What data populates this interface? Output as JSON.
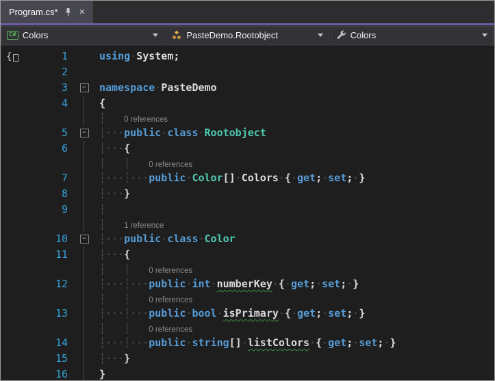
{
  "tab": {
    "title": "Program.cs*",
    "close_glyph": "×"
  },
  "navbar": {
    "project": {
      "icon_text": "C#",
      "label": "Colors"
    },
    "type_combo": {
      "label": "PasteDemo.Rootobject"
    },
    "member_combo": {
      "label": "Colors"
    }
  },
  "colors": {
    "accent_divider": "#6C5FA5",
    "tab_background": "#46464F",
    "navbar_background": "#2D2D30",
    "editor_background": "#1E1E1E",
    "keyword": "#569CD6",
    "type_name": "#4EC9B0",
    "plain_text": "#DCDCDC",
    "line_number": "#35A0D8",
    "codelens_text": "#8A8A8A",
    "whitespace_dot": "#4A5A55",
    "indent_guide": "#4F4F4F",
    "class_icon": "#D8A243",
    "csharp_icon": "#5BB75B"
  },
  "editor": {
    "rows": [
      {
        "kind": "code",
        "num": "1",
        "fold": "",
        "segs": [
          [
            "kw",
            "using"
          ],
          [
            "ws",
            "·"
          ],
          [
            "pl",
            "System;"
          ]
        ]
      },
      {
        "kind": "code",
        "num": "2",
        "fold": "",
        "segs": []
      },
      {
        "kind": "code",
        "num": "3",
        "fold": "box",
        "segs": [
          [
            "kw",
            "namespace"
          ],
          [
            "ws",
            "·"
          ],
          [
            "pl",
            "PasteDemo"
          ]
        ]
      },
      {
        "kind": "code",
        "num": "4",
        "fold": "line",
        "segs": [
          [
            "pl",
            "{"
          ]
        ]
      },
      {
        "kind": "lens",
        "num": "",
        "fold": "line",
        "segs": [
          [
            "gd",
            "┆"
          ],
          [
            "sp",
            "   "
          ],
          [
            "lens",
            "0 references"
          ]
        ]
      },
      {
        "kind": "code",
        "num": "5",
        "fold": "box",
        "segs": [
          [
            "gd",
            "┆"
          ],
          [
            "ws",
            "···"
          ],
          [
            "kw",
            "public"
          ],
          [
            "ws",
            "·"
          ],
          [
            "kw",
            "class"
          ],
          [
            "ws",
            "·"
          ],
          [
            "ty",
            "Rootobject"
          ]
        ]
      },
      {
        "kind": "code",
        "num": "6",
        "fold": "line",
        "segs": [
          [
            "gd",
            "┆"
          ],
          [
            "ws",
            "···"
          ],
          [
            "pl",
            "{"
          ]
        ]
      },
      {
        "kind": "lens",
        "num": "",
        "fold": "line",
        "segs": [
          [
            "gd",
            "┆"
          ],
          [
            "sp",
            "   "
          ],
          [
            "gd",
            "┆"
          ],
          [
            "sp",
            "   "
          ],
          [
            "lens",
            "0 references"
          ]
        ]
      },
      {
        "kind": "code",
        "num": "7",
        "fold": "line",
        "segs": [
          [
            "gd",
            "┆"
          ],
          [
            "ws",
            "···"
          ],
          [
            "gd",
            "┆"
          ],
          [
            "ws",
            "···"
          ],
          [
            "kw",
            "public"
          ],
          [
            "ws",
            "·"
          ],
          [
            "ty",
            "Color"
          ],
          [
            "pl",
            "[]"
          ],
          [
            "ws",
            "·"
          ],
          [
            "pl",
            "Colors"
          ],
          [
            "ws",
            "·"
          ],
          [
            "pl",
            "{"
          ],
          [
            "ws",
            "·"
          ],
          [
            "kw",
            "get"
          ],
          [
            "pl",
            ";"
          ],
          [
            "ws",
            "·"
          ],
          [
            "kw",
            "set"
          ],
          [
            "pl",
            ";"
          ],
          [
            "ws",
            "·"
          ],
          [
            "pl",
            "}"
          ]
        ]
      },
      {
        "kind": "code",
        "num": "8",
        "fold": "line",
        "segs": [
          [
            "gd",
            "┆"
          ],
          [
            "ws",
            "···"
          ],
          [
            "pl",
            "}"
          ]
        ]
      },
      {
        "kind": "code",
        "num": "9",
        "fold": "line",
        "segs": [
          [
            "gd",
            "┆"
          ]
        ]
      },
      {
        "kind": "lens",
        "num": "",
        "fold": "line",
        "segs": [
          [
            "gd",
            "┆"
          ],
          [
            "sp",
            "   "
          ],
          [
            "lens",
            "1 reference"
          ]
        ]
      },
      {
        "kind": "code",
        "num": "10",
        "fold": "box",
        "segs": [
          [
            "gd",
            "┆"
          ],
          [
            "ws",
            "···"
          ],
          [
            "kw",
            "public"
          ],
          [
            "ws",
            "·"
          ],
          [
            "kw",
            "class"
          ],
          [
            "ws",
            "·"
          ],
          [
            "ty",
            "Color"
          ]
        ]
      },
      {
        "kind": "code",
        "num": "11",
        "fold": "line",
        "segs": [
          [
            "gd",
            "┆"
          ],
          [
            "ws",
            "···"
          ],
          [
            "pl",
            "{"
          ]
        ]
      },
      {
        "kind": "lens",
        "num": "",
        "fold": "line",
        "segs": [
          [
            "gd",
            "┆"
          ],
          [
            "sp",
            "   "
          ],
          [
            "gd",
            "┆"
          ],
          [
            "sp",
            "   "
          ],
          [
            "lens",
            "0 references"
          ]
        ]
      },
      {
        "kind": "code",
        "num": "12",
        "fold": "line",
        "segs": [
          [
            "gd",
            "┆"
          ],
          [
            "ws",
            "···"
          ],
          [
            "gd",
            "┆"
          ],
          [
            "ws",
            "···"
          ],
          [
            "kw",
            "public"
          ],
          [
            "ws",
            "·"
          ],
          [
            "kw",
            "int"
          ],
          [
            "ws",
            "·"
          ],
          [
            "plu",
            "numberKey"
          ],
          [
            "ws",
            "·"
          ],
          [
            "pl",
            "{"
          ],
          [
            "ws",
            "·"
          ],
          [
            "kw",
            "get"
          ],
          [
            "pl",
            ";"
          ],
          [
            "ws",
            "·"
          ],
          [
            "kw",
            "set"
          ],
          [
            "pl",
            ";"
          ],
          [
            "ws",
            "·"
          ],
          [
            "pl",
            "}"
          ]
        ]
      },
      {
        "kind": "lens",
        "num": "",
        "fold": "line",
        "segs": [
          [
            "gd",
            "┆"
          ],
          [
            "sp",
            "   "
          ],
          [
            "gd",
            "┆"
          ],
          [
            "sp",
            "   "
          ],
          [
            "lens",
            "0 references"
          ]
        ]
      },
      {
        "kind": "code",
        "num": "13",
        "fold": "line",
        "segs": [
          [
            "gd",
            "┆"
          ],
          [
            "ws",
            "···"
          ],
          [
            "gd",
            "┆"
          ],
          [
            "ws",
            "···"
          ],
          [
            "kw",
            "public"
          ],
          [
            "ws",
            "·"
          ],
          [
            "kw",
            "bool"
          ],
          [
            "ws",
            "·"
          ],
          [
            "plu",
            "isPrimary"
          ],
          [
            "ws",
            "·"
          ],
          [
            "pl",
            "{"
          ],
          [
            "ws",
            "·"
          ],
          [
            "kw",
            "get"
          ],
          [
            "pl",
            ";"
          ],
          [
            "ws",
            "·"
          ],
          [
            "kw",
            "set"
          ],
          [
            "pl",
            ";"
          ],
          [
            "ws",
            "·"
          ],
          [
            "pl",
            "}"
          ]
        ]
      },
      {
        "kind": "lens",
        "num": "",
        "fold": "line",
        "segs": [
          [
            "gd",
            "┆"
          ],
          [
            "sp",
            "   "
          ],
          [
            "gd",
            "┆"
          ],
          [
            "sp",
            "   "
          ],
          [
            "lens",
            "0 references"
          ]
        ]
      },
      {
        "kind": "code",
        "num": "14",
        "fold": "line",
        "segs": [
          [
            "gd",
            "┆"
          ],
          [
            "ws",
            "···"
          ],
          [
            "gd",
            "┆"
          ],
          [
            "ws",
            "···"
          ],
          [
            "kw",
            "public"
          ],
          [
            "ws",
            "·"
          ],
          [
            "kw",
            "string"
          ],
          [
            "pl",
            "[]"
          ],
          [
            "ws",
            "·"
          ],
          [
            "plu",
            "listColors"
          ],
          [
            "ws",
            "·"
          ],
          [
            "pl",
            "{"
          ],
          [
            "ws",
            "·"
          ],
          [
            "kw",
            "get"
          ],
          [
            "pl",
            ";"
          ],
          [
            "ws",
            "·"
          ],
          [
            "kw",
            "set"
          ],
          [
            "pl",
            ";"
          ],
          [
            "ws",
            "·"
          ],
          [
            "pl",
            "}"
          ]
        ]
      },
      {
        "kind": "code",
        "num": "15",
        "fold": "line",
        "segs": [
          [
            "gd",
            "┆"
          ],
          [
            "ws",
            "···"
          ],
          [
            "pl",
            "}"
          ]
        ]
      },
      {
        "kind": "code",
        "num": "16",
        "fold": "line",
        "segs": [
          [
            "pl",
            "}"
          ]
        ]
      }
    ]
  }
}
